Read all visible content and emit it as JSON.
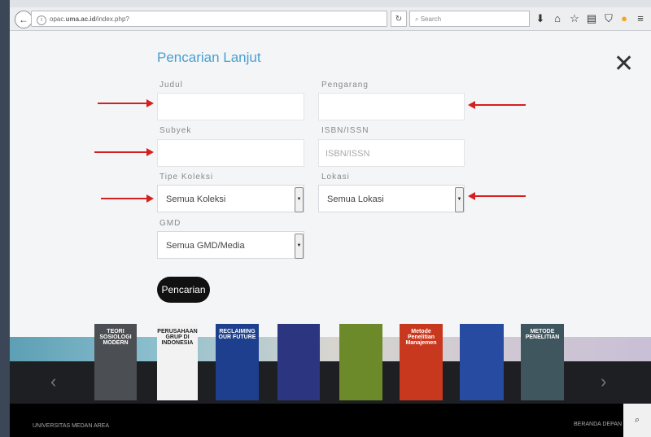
{
  "browser": {
    "url_prefix": "opac.",
    "url_domain": "uma.ac.id",
    "url_path": "/index.php?",
    "search_placeholder": "Search",
    "back_icon": "←",
    "reload_icon": "↻",
    "tools": [
      "⬇",
      "⌂",
      "☆",
      "▤",
      "⛉",
      "●",
      "≡"
    ]
  },
  "form": {
    "title": "Pencarian Lanjut",
    "close_icon": "✕",
    "judul_label": "Judul",
    "pengarang_label": "Pengarang",
    "subyek_label": "Subyek",
    "isbn_label": "ISBN/ISSN",
    "isbn_placeholder": "ISBN/ISSN",
    "tipe_label": "Tipe Koleksi",
    "tipe_value": "Semua Koleksi",
    "lokasi_label": "Lokasi",
    "lokasi_value": "Semua Lokasi",
    "gmd_label": "GMD",
    "gmd_value": "Semua GMD/Media",
    "submit_label": "Pencarian"
  },
  "books": [
    {
      "title": "TEORI SOSIOLOGI MODERN",
      "color": "#4b4e52"
    },
    {
      "title": "PERUSAHAAN GRUP DI INDONESIA",
      "color": "#f2f2f2"
    },
    {
      "title": "RECLAIMING OUR FUTURE",
      "color": "#1d3f8e"
    },
    {
      "title": "",
      "color": "#2c3580"
    },
    {
      "title": "",
      "color": "#6c8a2a"
    },
    {
      "title": "Metode Penelitian Manajemen",
      "color": "#c8381e"
    },
    {
      "title": "",
      "color": "#274ba0"
    },
    {
      "title": "METODE PENELITIAN",
      "color": "#40565f"
    }
  ],
  "carousel": {
    "prev_icon": "‹",
    "next_icon": "›"
  },
  "footer": {
    "left_text": "UNIVERSITAS MEDAN AREA",
    "right_text": "BERANDA DEPAN",
    "search_icon": "⌕"
  }
}
